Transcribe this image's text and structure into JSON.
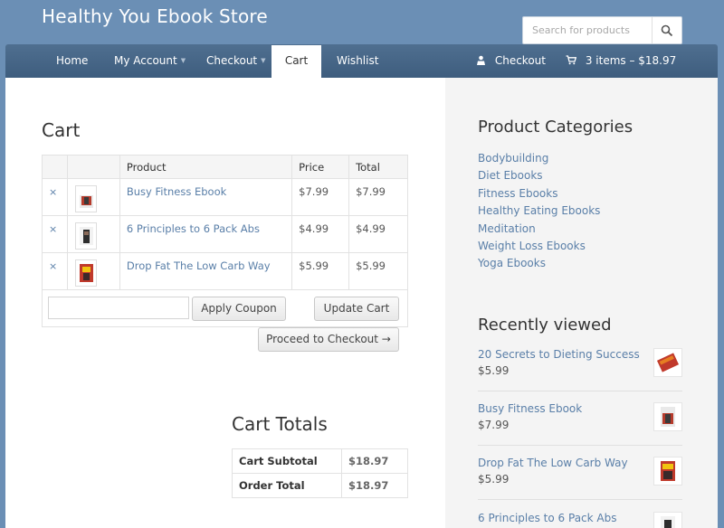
{
  "site": {
    "title": "Healthy You Ebook Store"
  },
  "search": {
    "placeholder": "Search for products"
  },
  "nav": {
    "items": [
      {
        "label": "Home"
      },
      {
        "label": "My Account"
      },
      {
        "label": "Checkout"
      },
      {
        "label": "Cart"
      },
      {
        "label": "Wishlist"
      }
    ],
    "right_checkout": "Checkout",
    "cart_summary": "3 items – $18.97"
  },
  "cart": {
    "heading": "Cart",
    "columns": [
      "Product",
      "Price",
      "Total"
    ],
    "rows": [
      {
        "remove": "×",
        "product": "Busy Fitness Ebook",
        "price": "$7.99",
        "total": "$7.99"
      },
      {
        "remove": "×",
        "product": "6 Principles to 6 Pack Abs",
        "price": "$4.99",
        "total": "$4.99"
      },
      {
        "remove": "×",
        "product": "Drop Fat The Low Carb Way",
        "price": "$5.99",
        "total": "$5.99"
      }
    ],
    "coupon_value": "",
    "apply_coupon": "Apply Coupon",
    "update_cart": "Update Cart",
    "proceed": "Proceed to Checkout →"
  },
  "totals": {
    "heading": "Cart Totals",
    "subtotal_label": "Cart Subtotal",
    "subtotal_value": "$18.97",
    "order_total_label": "Order Total",
    "order_total_value": "$18.97"
  },
  "sidebar": {
    "categories_heading": "Product Categories",
    "categories": [
      "Bodybuilding",
      "Diet Ebooks",
      "Fitness Ebooks",
      "Healthy Eating Ebooks",
      "Meditation",
      "Weight Loss Ebooks",
      "Yoga Ebooks"
    ],
    "recent_heading": "Recently viewed",
    "recent": [
      {
        "title": "20 Secrets to Dieting Success",
        "price": "$5.99"
      },
      {
        "title": "Busy Fitness Ebook",
        "price": "$7.99"
      },
      {
        "title": "Drop Fat The Low Carb Way",
        "price": "$5.99"
      },
      {
        "title": "6 Principles to 6 Pack Abs",
        "price": ""
      }
    ]
  },
  "colors": {
    "background": "#6b8fb5",
    "nav": "#46678a",
    "link": "#5a7fa8"
  }
}
